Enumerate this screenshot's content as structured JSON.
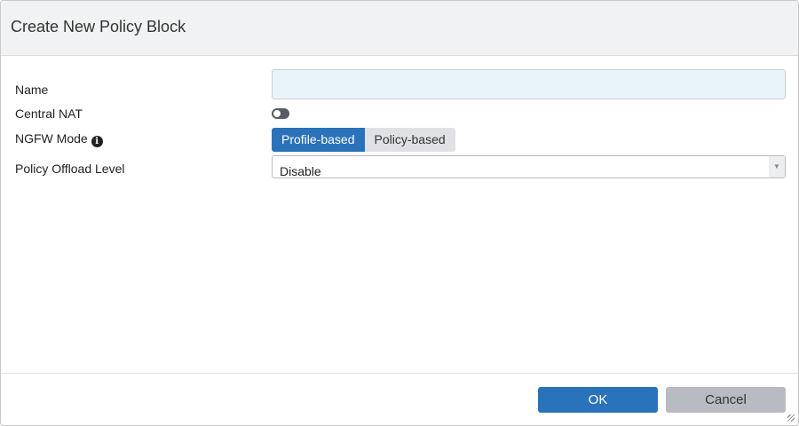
{
  "dialog": {
    "title": "Create New Policy Block"
  },
  "fields": {
    "name": {
      "label": "Name",
      "value": ""
    },
    "central_nat": {
      "label": "Central NAT",
      "enabled": false
    },
    "ngfw_mode": {
      "label": "NGFW Mode",
      "info_icon": "i",
      "options": [
        "Profile-based",
        "Policy-based"
      ],
      "selected": "Profile-based"
    },
    "offload": {
      "label": "Policy Offload Level",
      "value": "Disable",
      "caret": "▼"
    }
  },
  "footer": {
    "ok_label": "OK",
    "cancel_label": "Cancel"
  }
}
